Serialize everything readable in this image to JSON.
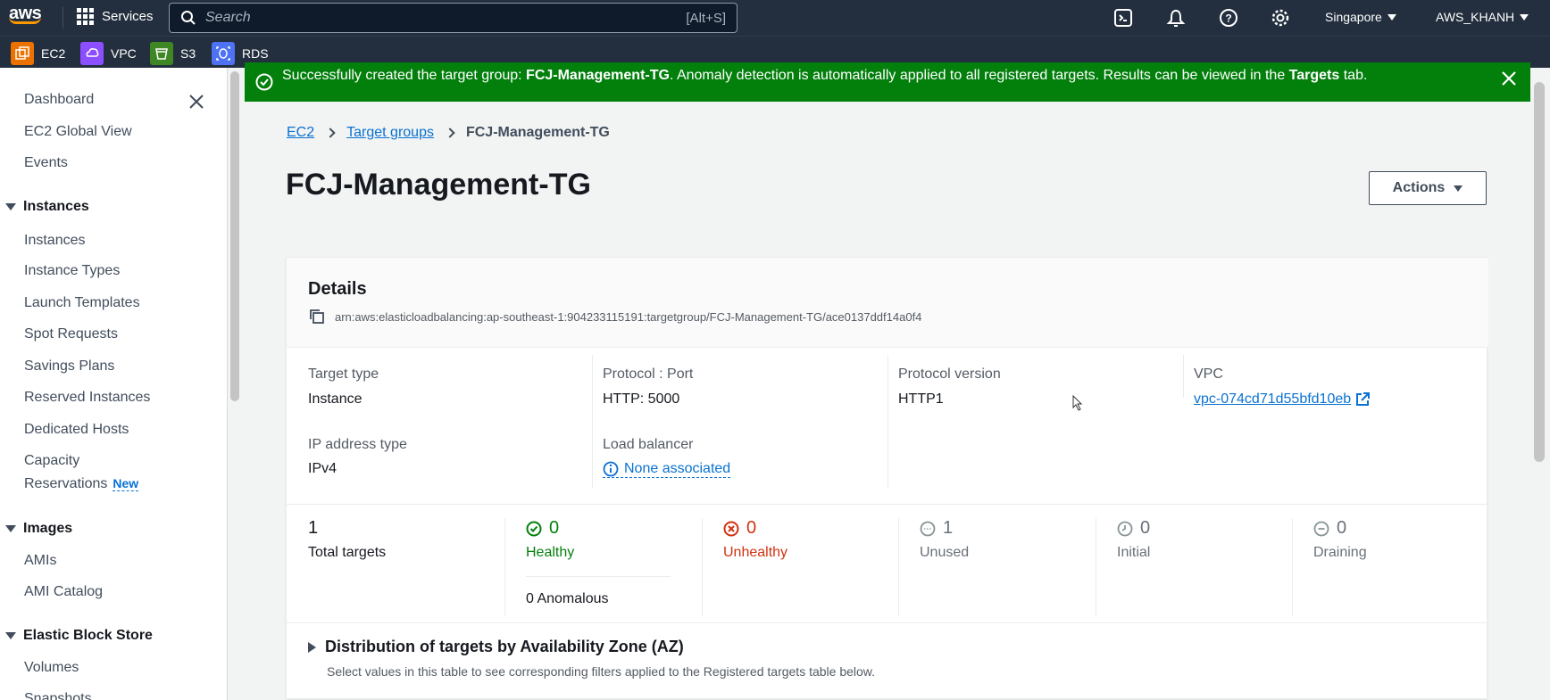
{
  "topbar": {
    "logo": "aws",
    "services_label": "Services",
    "search_placeholder": "Search",
    "search_shortcut": "[Alt+S]",
    "region": "Singapore",
    "account": "AWS_KHANH",
    "icons": [
      "cloudshell-icon",
      "notifications-icon",
      "help-icon",
      "settings-icon"
    ]
  },
  "favorites": [
    {
      "label": "EC2",
      "color": "#ed7100"
    },
    {
      "label": "VPC",
      "color": "#8c4fff"
    },
    {
      "label": "S3",
      "color": "#3f8624"
    },
    {
      "label": "RDS",
      "color": "#4d72f3"
    }
  ],
  "sidebar": {
    "top_items": [
      "Dashboard",
      "EC2 Global View",
      "Events"
    ],
    "instances_header": "Instances",
    "instances_items": [
      "Instances",
      "Instance Types",
      "Launch Templates",
      "Spot Requests",
      "Savings Plans",
      "Reserved Instances",
      "Dedicated Hosts"
    ],
    "capacity_line1": "Capacity",
    "capacity_line2": "Reservations",
    "new_badge": "New",
    "images_header": "Images",
    "images_items": [
      "AMIs",
      "AMI Catalog"
    ],
    "ebs_header": "Elastic Block Store",
    "ebs_items": [
      "Volumes",
      "Snapshots"
    ]
  },
  "flash": {
    "prefix": "Successfully created the target group: ",
    "name": "FCJ-Management-TG",
    "middle": ". Anomaly detection is automatically applied to all registered targets. Results can be viewed in the ",
    "tab": "Targets",
    "suffix": " tab.",
    "color": "#037f0c"
  },
  "breadcrumb": {
    "items": [
      "EC2",
      "Target groups"
    ],
    "current": "FCJ-Management-TG"
  },
  "page": {
    "title": "FCJ-Management-TG",
    "actions_label": "Actions"
  },
  "details": {
    "title": "Details",
    "arn": "arn:aws:elasticloadbalancing:ap-southeast-1:904233115191:targetgroup/FCJ-Management-TG/ace0137ddf14a0f4",
    "target_type_label": "Target type",
    "target_type": "Instance",
    "protocol_port_label": "Protocol : Port",
    "protocol_port": "HTTP: 5000",
    "protocol_version_label": "Protocol version",
    "protocol_version": "HTTP1",
    "vpc_label": "VPC",
    "vpc": "vpc-074cd71d55bfd10eb",
    "ip_type_label": "IP address type",
    "ip_type": "IPv4",
    "load_balancer_label": "Load balancer",
    "load_balancer": "None associated"
  },
  "stats": {
    "total": "1",
    "total_label": "Total targets",
    "healthy": "0",
    "healthy_label": "Healthy",
    "anomalous": "0 Anomalous",
    "unhealthy": "0",
    "unhealthy_label": "Unhealthy",
    "unused": "1",
    "unused_label": "Unused",
    "initial": "0",
    "initial_label": "Initial",
    "draining": "0",
    "draining_label": "Draining"
  },
  "distribution": {
    "title": "Distribution of targets by Availability Zone (AZ)",
    "description": "Select values in this table to see corresponding filters applied to the Registered targets table below."
  }
}
